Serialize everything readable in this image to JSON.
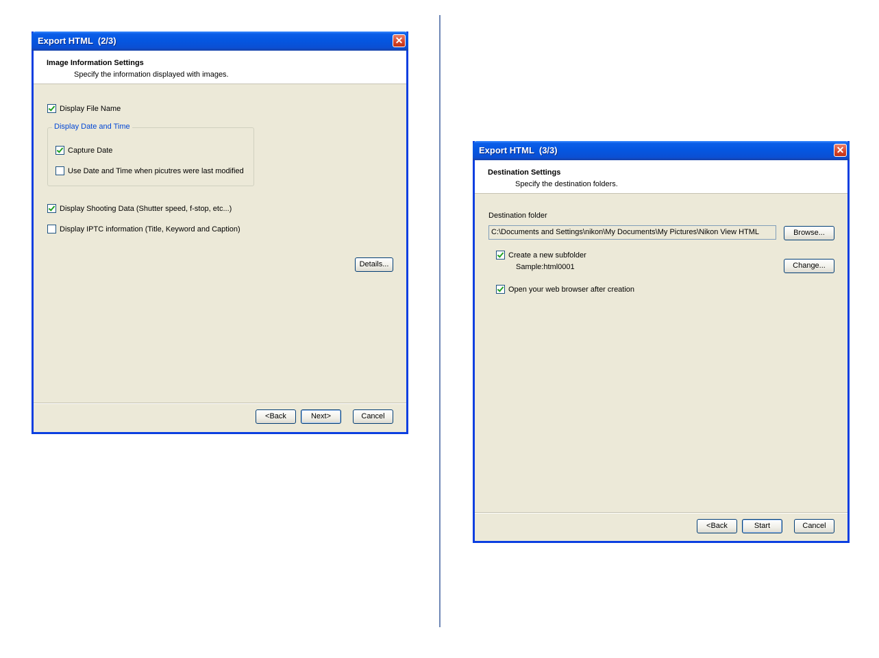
{
  "dialog1": {
    "title": "Export HTML  (2/3)",
    "close_glyph": "✕",
    "header_title": "Image Information Settings",
    "header_subtitle": "Specify the information displayed with images.",
    "display_file_name": {
      "label": "Display File Name",
      "checked": true
    },
    "group_label": "Display Date and Time",
    "capture_date": {
      "label": "Capture Date",
      "checked": true
    },
    "use_modified_date": {
      "label": "Use Date and Time when picutres were last modified",
      "checked": false
    },
    "shooting_data": {
      "label": "Display Shooting Data (Shutter speed, f-stop, etc...)",
      "checked": true
    },
    "iptc_info": {
      "label": "Display IPTC information (Title, Keyword and Caption)",
      "checked": false
    },
    "details_button": "Details...",
    "back_button": "<Back",
    "next_button": "Next>",
    "cancel_button": "Cancel"
  },
  "dialog2": {
    "title": "Export HTML  (3/3)",
    "close_glyph": "✕",
    "header_title": "Destination Settings",
    "header_subtitle": "Specify the destination folders.",
    "destination_label": "Destination folder",
    "destination_path": "C:\\Documents and Settings\\nikon\\My Documents\\My Pictures\\Nikon View HTML",
    "browse_button": "Browse...",
    "create_subfolder": {
      "label": "Create a new subfolder",
      "checked": true
    },
    "sample_text": "Sample:html0001",
    "change_button": "Change...",
    "open_browser": {
      "label": "Open your web browser after creation",
      "checked": true
    },
    "back_button": "<Back",
    "start_button": "Start",
    "cancel_button": "Cancel"
  },
  "colors": {
    "titlebar": "#0556e0",
    "dialog_bg": "#ece9d8",
    "groupbox_label": "#0046d5",
    "divider": "#6f88b6"
  }
}
